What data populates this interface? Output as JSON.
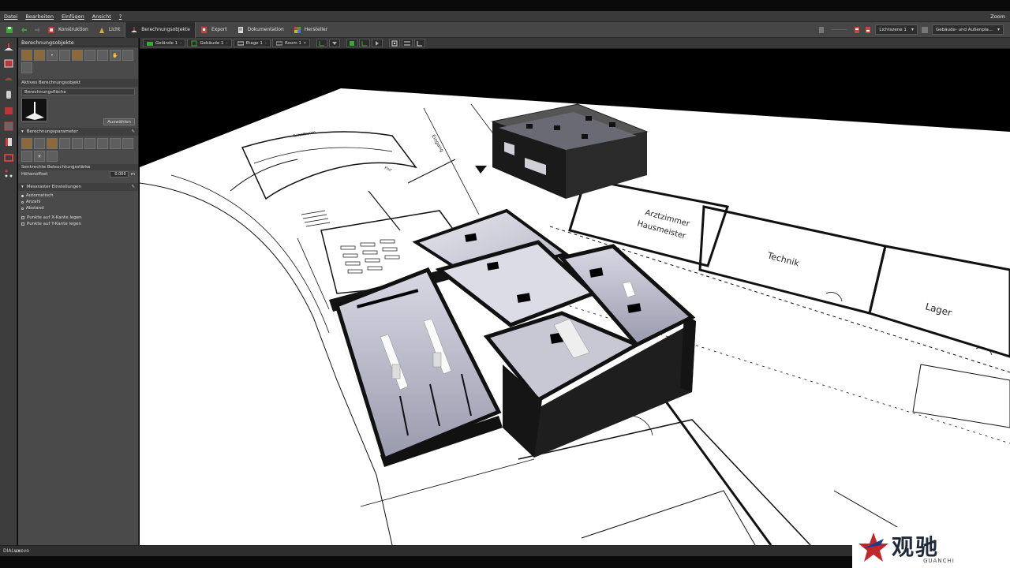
{
  "menubar": {
    "items": [
      "Datei",
      "Bearbeiten",
      "Einfügen",
      "Ansicht",
      "?"
    ],
    "zoom": "Zoom"
  },
  "toolbar": {
    "tabs": [
      {
        "label": "Konstruktion",
        "active": false
      },
      {
        "label": "Licht",
        "active": false
      },
      {
        "label": "Berechnungsobjekte",
        "active": true
      },
      {
        "label": "Export",
        "active": false
      },
      {
        "label": "Dokumentation",
        "active": false
      },
      {
        "label": "Hersteller",
        "active": false
      }
    ],
    "lightscene_value": "Lichtszene 1",
    "view_value": "Gebäude- und Außenpla..."
  },
  "panel": {
    "title": "Berechnungsobjekte",
    "active_section": "Aktives Berechnungsobjekt",
    "active_object": "Berechnungsfläche",
    "select_button": "Auswählen",
    "params_section": "Berechnungsparameter",
    "illuminance_label": "Senkrechte Beleuchtungsstärke",
    "height_offset_label": "Höhenoffset",
    "height_offset_value": "0.000",
    "height_offset_unit": "m",
    "grid_section": "Messraster Einstellungen",
    "grid_options": [
      "Automatisch",
      "Anzahl",
      "Abstand"
    ],
    "edge_options": [
      "Punkte auf X-Kante legen",
      "Punkte auf Y-Kante legen"
    ]
  },
  "viewtoolbar": {
    "breadcrumb": [
      "Gelände 1",
      "Gebäude 1",
      "Etage 1",
      "Room 1"
    ]
  },
  "plan_labels": {
    "arzt": "Arztzimmer",
    "haus": "Hausmeister",
    "technik": "Technik",
    "lager": "Lager",
    "flur": "Eingang",
    "small1": "Schaltraum",
    "small2": "Flur"
  },
  "statusbar": {
    "brand_prefix": "DIAL",
    "brand_mid": "ux",
    "brand_suffix": "evo"
  },
  "watermark": {
    "text": "观驰",
    "sub": "GUANCHI"
  },
  "colors": {
    "accent_green": "#3aa838",
    "accent_orange": "#d08a2a",
    "accent_red": "#b43a3a"
  }
}
